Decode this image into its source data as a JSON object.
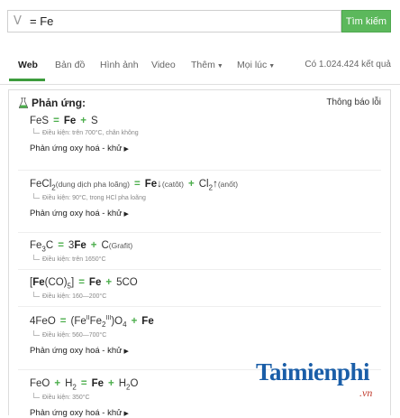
{
  "search": {
    "prefix": "V",
    "query": "= Fe",
    "button_label": "Tìm kiếm"
  },
  "nav": {
    "items": [
      "Web",
      "Bản đồ",
      "Hình ảnh",
      "Video",
      "Thêm",
      "Mọi lúc"
    ],
    "result_count": "Có 1.024.424 kết quả"
  },
  "panel": {
    "title": "Phản ứng:",
    "report_link": "Thông báo lỗi",
    "redox_label": "Phản ứng oxy hoá - khử",
    "reactions": [
      {
        "condition": "Điều kiện: trên 700°C, chân không"
      },
      {
        "reactant_note": "dung dịch pha loãng",
        "product_note_1": "catôt",
        "product_note_2": "anốt",
        "condition": "Điều kiện: 90°C, trong HCl pha loãng"
      },
      {
        "product_note": "Grafit",
        "condition": "Điều kiện: trên 1650°C"
      },
      {
        "condition": "Điều kiện: 160—200°C"
      },
      {
        "condition": "Điều kiện: 560—700°C"
      },
      {
        "condition": "Điều kiện: 350°C"
      }
    ]
  },
  "watermark": {
    "brand": "Taimienphi",
    "domain": ".vn"
  }
}
